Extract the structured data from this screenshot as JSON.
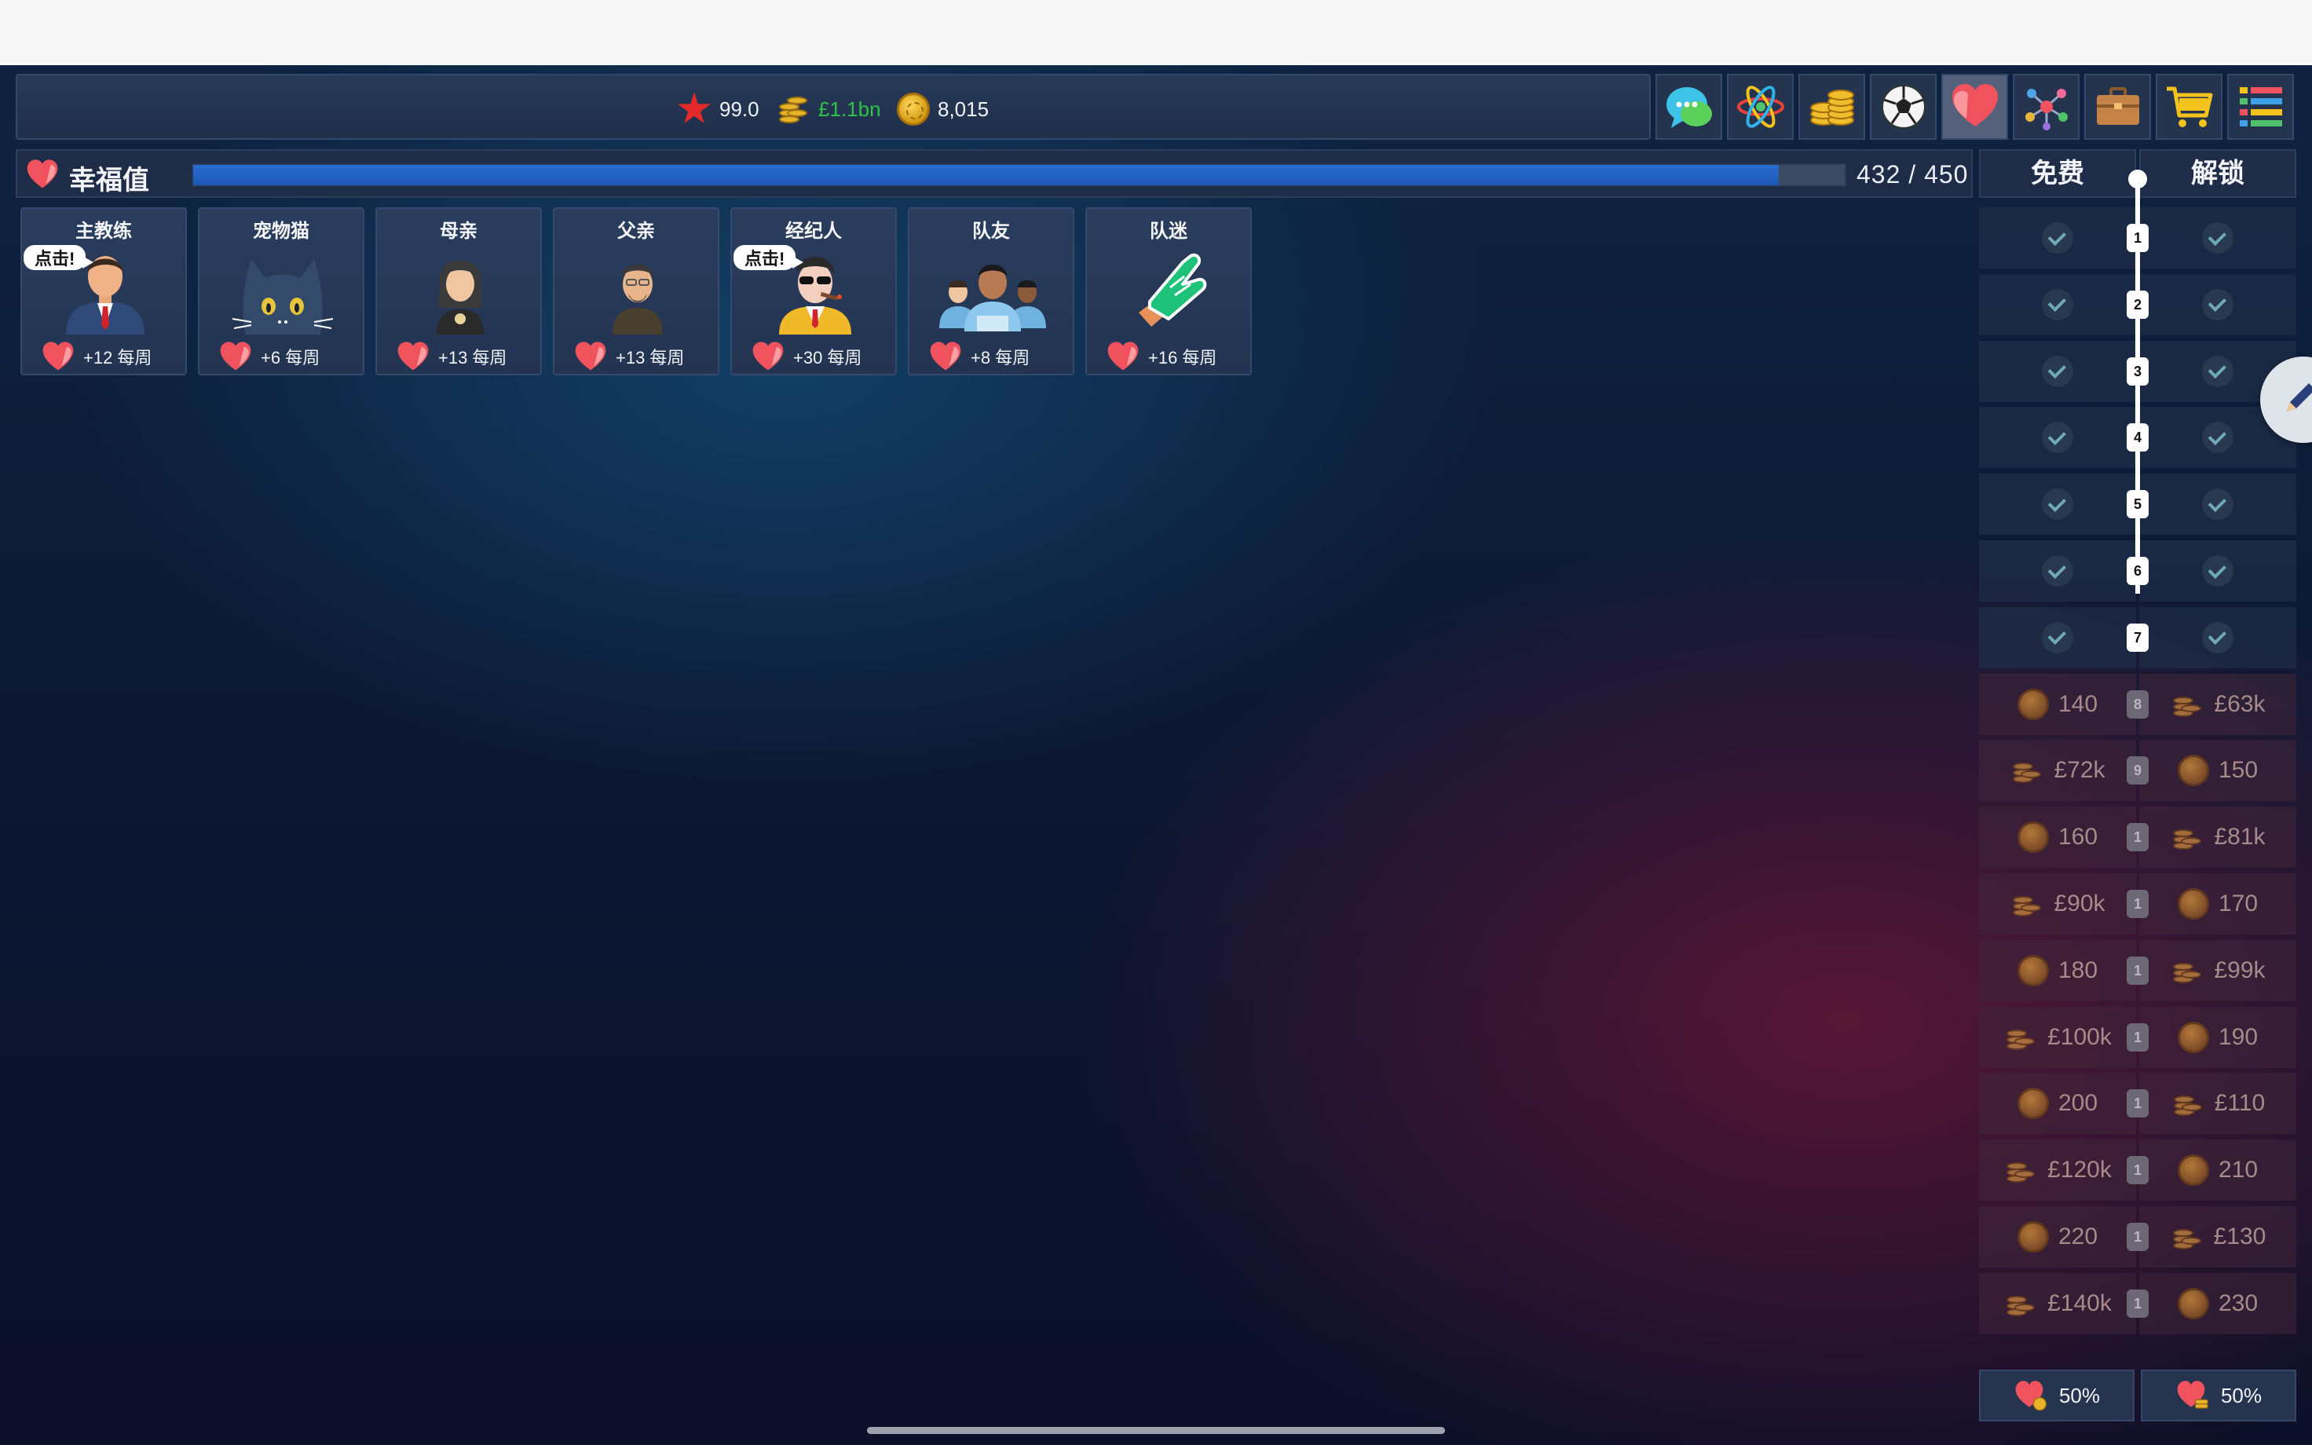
{
  "hud": {
    "rating": "99.0",
    "money": "£1.1bn",
    "coins": "8,015",
    "nav_icons": [
      "chat-icon",
      "atom-icon",
      "coins-icon",
      "football-icon",
      "heart-icon",
      "network-icon",
      "briefcase-icon",
      "cart-icon",
      "list-icon"
    ],
    "active_nav": "heart-icon"
  },
  "happiness": {
    "title": "幸福值",
    "value_text": "432 / 450",
    "current": 432,
    "max": 450
  },
  "cards": [
    {
      "name": "主教练",
      "bonus": "+12 每周",
      "tap": "点击!",
      "icon": "coach-icon"
    },
    {
      "name": "宠物猫",
      "bonus": "+6 每周",
      "tap": "",
      "icon": "cat-icon"
    },
    {
      "name": "母亲",
      "bonus": "+13 每周",
      "tap": "",
      "icon": "mother-icon"
    },
    {
      "name": "父亲",
      "bonus": "+13 每周",
      "tap": "",
      "icon": "father-icon"
    },
    {
      "name": "经纪人",
      "bonus": "+30 每周",
      "tap": "点击!",
      "icon": "agent-icon"
    },
    {
      "name": "队友",
      "bonus": "+8 每周",
      "tap": "",
      "icon": "teammates-icon"
    },
    {
      "name": "队迷",
      "bonus": "+16 每周",
      "tap": "",
      "icon": "foam-finger-icon"
    }
  ],
  "rewards": {
    "free_label": "免费",
    "unlock_label": "解锁",
    "rows": [
      {
        "level": "1",
        "claimed": true
      },
      {
        "level": "2",
        "claimed": true
      },
      {
        "level": "3",
        "claimed": true
      },
      {
        "level": "4",
        "claimed": true
      },
      {
        "level": "5",
        "claimed": true
      },
      {
        "level": "6",
        "claimed": true
      },
      {
        "level": "7",
        "claimed": true
      },
      {
        "level": "8",
        "claimed": false,
        "free": "140",
        "free_type": "coin",
        "unlock": "£63k",
        "unlock_type": "cash"
      },
      {
        "level": "9",
        "claimed": false,
        "free": "£72k",
        "free_type": "cash",
        "unlock": "150",
        "unlock_type": "coin"
      },
      {
        "level": "1",
        "claimed": false,
        "free": "160",
        "free_type": "coin",
        "unlock": "£81k",
        "unlock_type": "cash"
      },
      {
        "level": "1",
        "claimed": false,
        "free": "£90k",
        "free_type": "cash",
        "unlock": "170",
        "unlock_type": "coin"
      },
      {
        "level": "1",
        "claimed": false,
        "free": "180",
        "free_type": "coin",
        "unlock": "£99k",
        "unlock_type": "cash"
      },
      {
        "level": "1",
        "claimed": false,
        "free": "£100k",
        "free_type": "cash",
        "unlock": "190",
        "unlock_type": "coin"
      },
      {
        "level": "1",
        "claimed": false,
        "free": "200",
        "free_type": "coin",
        "unlock": "£110",
        "unlock_type": "cash"
      },
      {
        "level": "1",
        "claimed": false,
        "free": "£120k",
        "free_type": "cash",
        "unlock": "210",
        "unlock_type": "coin"
      },
      {
        "level": "1",
        "claimed": false,
        "free": "220",
        "free_type": "coin",
        "unlock": "£130",
        "unlock_type": "cash"
      },
      {
        "level": "1",
        "claimed": false,
        "free": "£140k",
        "free_type": "cash",
        "unlock": "230",
        "unlock_type": "coin"
      }
    ],
    "bottom_left": "50%",
    "bottom_right": "50%"
  },
  "colors": {
    "heart": "#f0535d",
    "progress": "#1f5fc4",
    "money_green": "#2ec24a"
  }
}
